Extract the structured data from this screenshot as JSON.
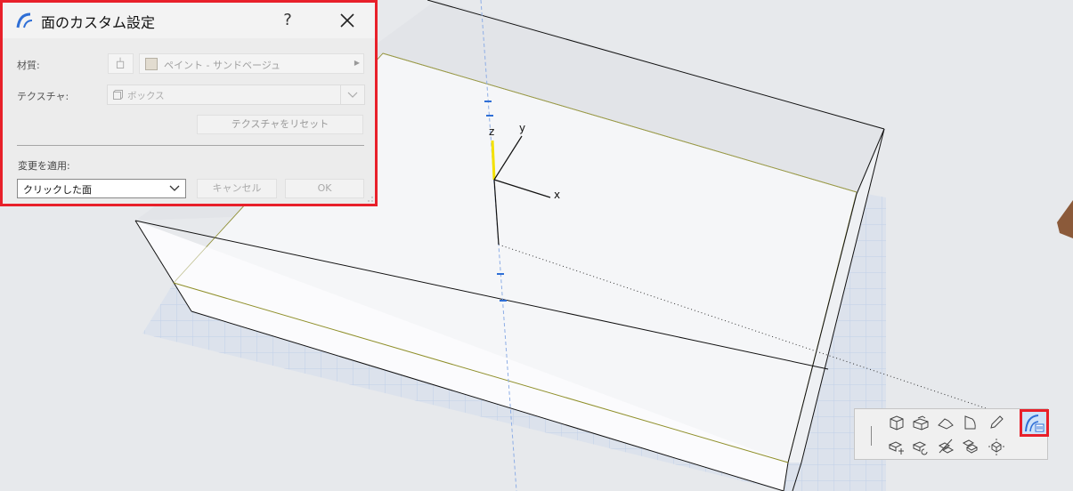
{
  "dialog": {
    "title": "面のカスタム設定",
    "help_label": "?",
    "material_label": "材質:",
    "material_value": "ペイント - サンドベージュ",
    "material_swatch_color": "#e2dcd0",
    "texture_label": "テクスチャ:",
    "texture_value": "ボックス",
    "reset_texture_label": "テクスチャをリセット",
    "apply_changes_label": "変更を適用:",
    "apply_target_value": "クリックした面",
    "cancel_label": "キャンセル",
    "ok_label": "OK"
  },
  "scene": {
    "axes": {
      "x": "x",
      "y": "y",
      "z": "z"
    }
  },
  "toolbar": {
    "icons": [
      "box-face-icon",
      "extrude-icon",
      "roof-icon",
      "surface-icon",
      "pencil-icon",
      "custom-face-settings-icon",
      "move-icon",
      "rotate-icon",
      "offset-icon",
      "stack-icon",
      "explode-icon"
    ]
  },
  "colors": {
    "highlight_red": "#e8202a",
    "accent_blue": "#2f6fd6",
    "selection_yellow": "#f4e100"
  }
}
